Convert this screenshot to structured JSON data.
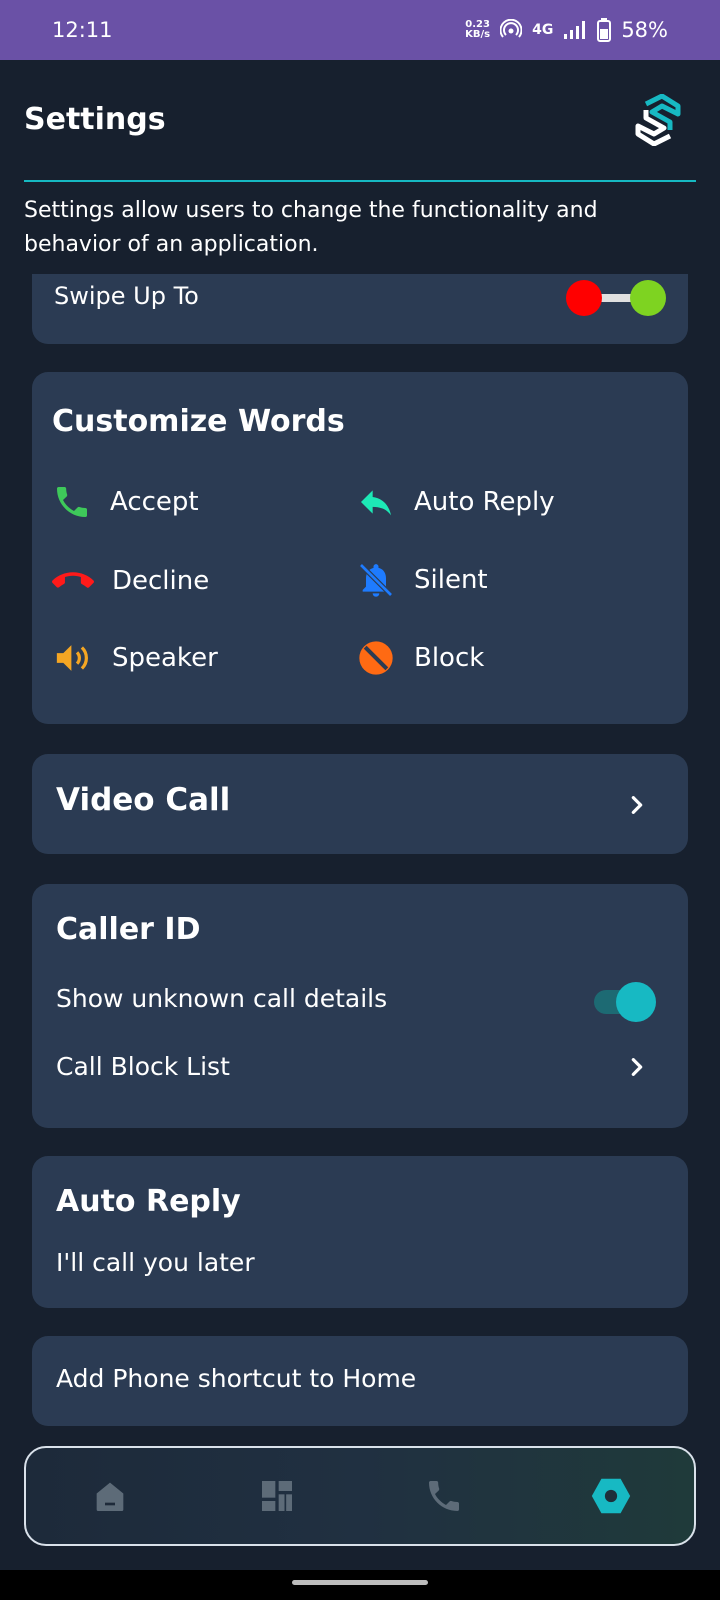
{
  "status_bar": {
    "time": "12:11",
    "net_speed_value": "0.23",
    "net_speed_unit": "KB/s",
    "network": "4G",
    "battery": "58%"
  },
  "header": {
    "title": "Settings",
    "subtitle": "Settings allow users to change the functionality and behavior of an application."
  },
  "swipe_up": {
    "label": "Swipe Up To",
    "toggle_colors": [
      "#ff0000",
      "#7ed321"
    ]
  },
  "customize_words": {
    "title": "Customize Words",
    "items": [
      {
        "label": "Accept",
        "icon": "phone-accept-icon",
        "color": "#3ec95a"
      },
      {
        "label": "Auto Reply",
        "icon": "reply-icon",
        "color": "#1de9b6"
      },
      {
        "label": "Decline",
        "icon": "phone-decline-icon",
        "color": "#ff1a1a"
      },
      {
        "label": "Silent",
        "icon": "bell-off-icon",
        "color": "#1e7bff"
      },
      {
        "label": "Speaker",
        "icon": "speaker-icon",
        "color": "#f5a623"
      },
      {
        "label": "Block",
        "icon": "block-icon",
        "color": "#ff6a13"
      }
    ]
  },
  "video_call": {
    "label": "Video Call"
  },
  "caller_id": {
    "title": "Caller ID",
    "show_unknown_label": "Show unknown call details",
    "show_unknown_enabled": true,
    "block_list_label": "Call Block List"
  },
  "auto_reply": {
    "title": "Auto Reply",
    "message": "I'll call you later"
  },
  "shortcut": {
    "label": "Add Phone shortcut to Home"
  },
  "bottom_nav": {
    "items": [
      {
        "icon": "home-icon",
        "active": false
      },
      {
        "icon": "dashboard-icon",
        "active": false
      },
      {
        "icon": "phone-icon",
        "active": false
      },
      {
        "icon": "settings-hex-icon",
        "active": true
      }
    ],
    "accent_color": "#17b9c3",
    "inactive_color": "#5d6b78"
  }
}
